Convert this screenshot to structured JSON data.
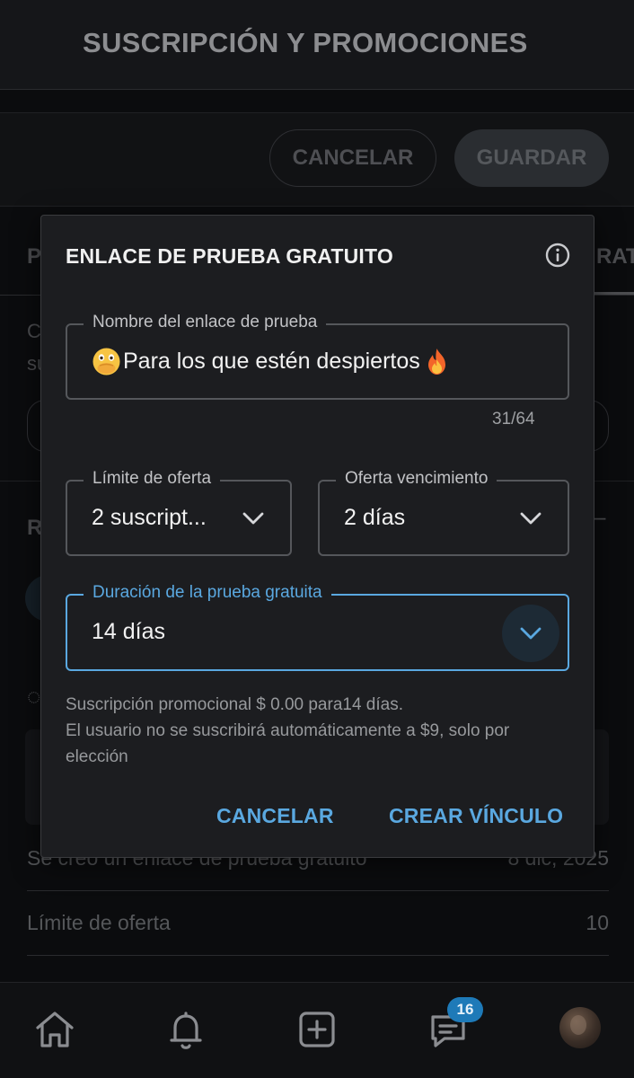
{
  "header": {
    "title": "SUSCRIPCIÓN Y PROMOCIONES"
  },
  "actions": {
    "cancel_label": "CANCELAR",
    "save_label": "GUARDAR"
  },
  "background": {
    "tab_left_fragment": "P",
    "tab_right_fragment": "RATU",
    "text_fragment_c": "C",
    "text_fragment_su": "su",
    "section_fragment_r": "R",
    "rows": [
      {
        "label": "Se creó un enlace de prueba gratuito",
        "value": "8 dic, 2025"
      },
      {
        "label": "Límite de oferta",
        "value": "10"
      }
    ]
  },
  "modal": {
    "title": "ENLACE DE PRUEBA GRATUITO",
    "info_icon": "info-icon",
    "name_field": {
      "label": "Nombre del enlace de prueba",
      "value": "Para los que estén despiertos",
      "prefix_emoji": "face-with-open-eyes-and-hand-over-mouth",
      "suffix_emoji": "fire",
      "counter": "31/64"
    },
    "offer_limit": {
      "label": "Límite de oferta",
      "value": "2 suscript..."
    },
    "offer_expiry": {
      "label": "Oferta vencimiento",
      "value": "2 días"
    },
    "trial_duration": {
      "label": "Duración de la prueba gratuita",
      "value": "14 días"
    },
    "promo_lines": [
      "Suscripción promocional $ 0.00 para14 días.",
      "El usuario no se suscribirá automáticamente a $9, solo por",
      "elección"
    ],
    "cancel_label": "CANCELAR",
    "create_label": "CREAR VÍNCULO"
  },
  "bottom_nav": {
    "items": [
      "home-icon",
      "notifications-icon",
      "add-post-icon",
      "messages-icon",
      "profile-avatar"
    ],
    "messages_badge": "16"
  },
  "colors": {
    "accent": "#5aa8e0",
    "modal_bg": "#1c1d20",
    "page_bg": "#0b0c0e",
    "badge": "#1e7ab8"
  }
}
